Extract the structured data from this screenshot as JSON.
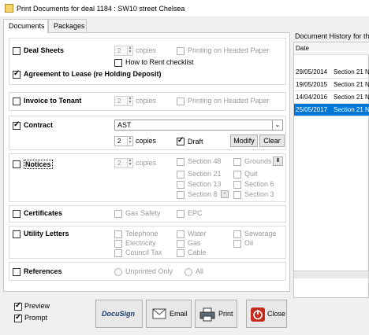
{
  "window": {
    "title": "Print Documents for deal 1184 : SW10 street Chelsea"
  },
  "tabs": [
    "Documents",
    "Packages"
  ],
  "sections": {
    "deal_sheets": {
      "label": "Deal Sheets",
      "copies_value": "2",
      "copies_label": "copies",
      "headed_paper": "Printing on Headed Paper",
      "how_to_rent": "How to Rent checklist"
    },
    "agreement": {
      "label": "Agreement to Lease (re Holding Deposit)"
    },
    "invoice": {
      "label": "Invoice to Tenant",
      "copies_value": "2",
      "copies_label": "copies",
      "headed_paper": "Printing on Headed Paper"
    },
    "contract": {
      "label": "Contract",
      "type_value": "AST",
      "copies_value": "2",
      "copies_label": "copies",
      "draft": "Draft",
      "modify": "Modify",
      "clear": "Clear"
    },
    "notices": {
      "label": "Notices",
      "copies_value": "2",
      "copies_label": "copies",
      "options": [
        "Section 48",
        "Grounds",
        "Section 21",
        "Quit",
        "Section 13",
        "Section 6",
        "Section 8",
        "Section 3"
      ]
    },
    "certificates": {
      "label": "Certificates",
      "options": [
        "Gas Safety",
        "EPC"
      ]
    },
    "utility": {
      "label": "Utility Letters",
      "options": [
        "Telephone",
        "Water",
        "Sewerage",
        "Electricity",
        "Gas",
        "Oil",
        "Council Tax",
        "Cable"
      ]
    },
    "references": {
      "label": "References",
      "options": [
        "Unprinted Only",
        "All"
      ]
    }
  },
  "history": {
    "title": "Document History for this",
    "column": "Date",
    "rows": [
      {
        "date": "29/05/2014",
        "desc": "Section 21 N"
      },
      {
        "date": "19/05/2015",
        "desc": "Section 21 N"
      },
      {
        "date": "14/04/2016",
        "desc": "Section 21 N"
      },
      {
        "date": "25/05/2017",
        "desc": "Section 21 N",
        "selected": true
      }
    ]
  },
  "footer": {
    "preview": "Preview",
    "prompt": "Prompt",
    "docusign": "DocuSign",
    "email": "Email",
    "print": "Print",
    "close": "Close"
  },
  "colors": {
    "selection": "#0078d7",
    "close_red": "#c42b1c"
  }
}
